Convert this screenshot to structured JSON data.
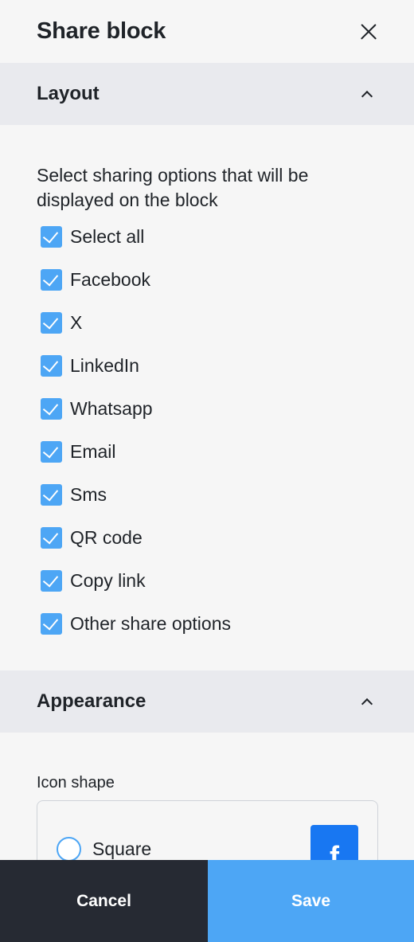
{
  "header": {
    "title": "Share block",
    "close_icon": "close-icon"
  },
  "layout_section": {
    "title": "Layout",
    "description": "Select sharing options that will be displayed on the block",
    "options": [
      {
        "label": "Select all",
        "checked": true
      },
      {
        "label": "Facebook",
        "checked": true
      },
      {
        "label": "X",
        "checked": true
      },
      {
        "label": "LinkedIn",
        "checked": true
      },
      {
        "label": "Whatsapp",
        "checked": true
      },
      {
        "label": "Email",
        "checked": true
      },
      {
        "label": "Sms",
        "checked": true
      },
      {
        "label": "QR code",
        "checked": true
      },
      {
        "label": "Copy link",
        "checked": true
      },
      {
        "label": "Other share options",
        "checked": true
      }
    ]
  },
  "appearance_section": {
    "title": "Appearance",
    "icon_shape_label": "Icon shape",
    "shape_option": {
      "label": "Square",
      "selected": false,
      "preview_letter": "f"
    }
  },
  "footer": {
    "cancel_label": "Cancel",
    "save_label": "Save"
  },
  "colors": {
    "accent": "#4da6f5",
    "section_header_bg": "#e9eaee",
    "cancel_bg": "#262a33",
    "facebook_blue": "#1877f2"
  }
}
